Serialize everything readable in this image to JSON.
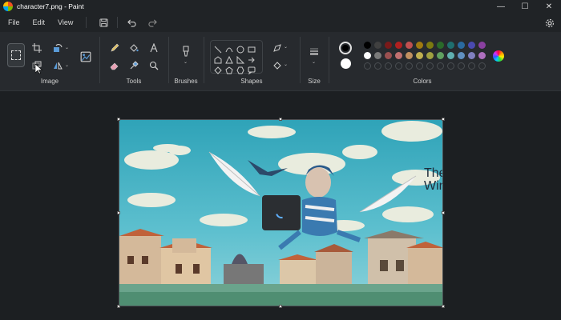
{
  "window": {
    "title": "character7.png - Paint",
    "controls": {
      "minimize": "—",
      "maximize": "☐",
      "close": "✕"
    }
  },
  "menu": {
    "items": [
      "File",
      "Edit",
      "View"
    ],
    "quick_access": [
      "save-icon",
      "undo-icon",
      "redo-icon"
    ],
    "settings_icon": "gear-icon"
  },
  "ribbon": {
    "groups": {
      "image": {
        "label": "Image"
      },
      "tools": {
        "label": "Tools"
      },
      "brushes": {
        "label": "Brushes"
      },
      "shapes": {
        "label": "Shapes"
      },
      "size": {
        "label": "Size"
      },
      "colors": {
        "label": "Colors"
      }
    }
  },
  "colors": {
    "color1": "#000000",
    "color2": "#ffffff",
    "palette_row1": [
      "#000000",
      "#404040",
      "#7a1a1a",
      "#b02020",
      "#c05050",
      "#a07a10",
      "#7c7a10",
      "#2a6a2a",
      "#1f6f6f",
      "#2a6aa0",
      "#4a4ab0",
      "#8a40a0"
    ],
    "palette_row2": [
      "#ffffff",
      "#7a7a7a",
      "#9a5050",
      "#c07070",
      "#c09060",
      "#c0b050",
      "#a0a040",
      "#60a060",
      "#60b0b0",
      "#6090c0",
      "#8080c0",
      "#b070c0"
    ],
    "palette_row3_empty": 12
  },
  "canvas": {
    "loading_indicator": "spinner",
    "watermark": {
      "line1": "The",
      "line2": "WindowsClub"
    }
  }
}
